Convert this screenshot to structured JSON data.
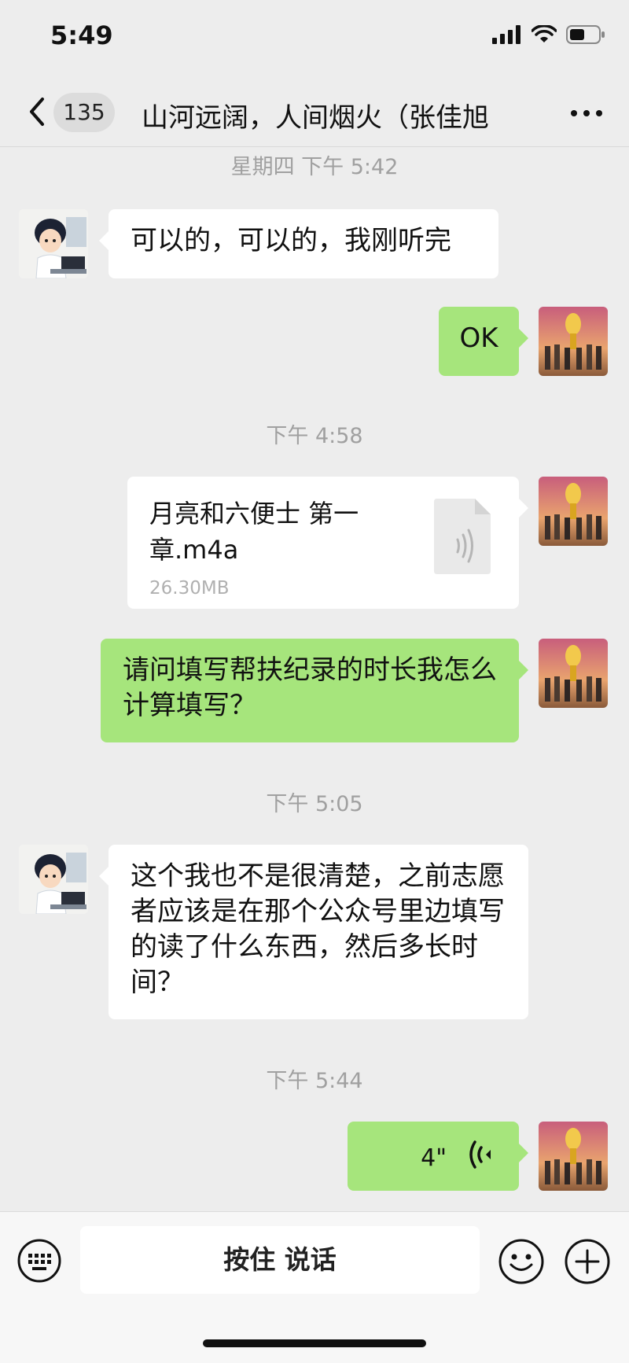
{
  "status_bar": {
    "time": "5:49"
  },
  "header": {
    "badge": "135",
    "title": "山河远阔，人间烟火（张佳旭"
  },
  "timestamps": [
    "星期四 下午 5:42",
    "下午 4:58",
    "下午 5:05",
    "下午 5:44"
  ],
  "messages": [
    {
      "side": "left",
      "text": "可以的，可以的，我刚听完"
    },
    {
      "side": "right",
      "text": "OK"
    },
    {
      "side": "right",
      "type": "file",
      "file_name": "月亮和六便士  第一章.m4a",
      "file_size": "26.30MB"
    },
    {
      "side": "right",
      "text": "请问填写帮扶纪录的时长我怎么计算填写？"
    },
    {
      "side": "left",
      "text": "这个我也不是很清楚，之前志愿者应该是在那个公众号里边填写的读了什么东西，然后多长时间？"
    },
    {
      "side": "right",
      "type": "voice",
      "duration": "4\""
    }
  ],
  "bottom_bar": {
    "talk_label": "按住 说话"
  },
  "colors": {
    "background": "#ededed",
    "green_bubble": "#a6e57c",
    "white_bubble": "#ffffff"
  }
}
